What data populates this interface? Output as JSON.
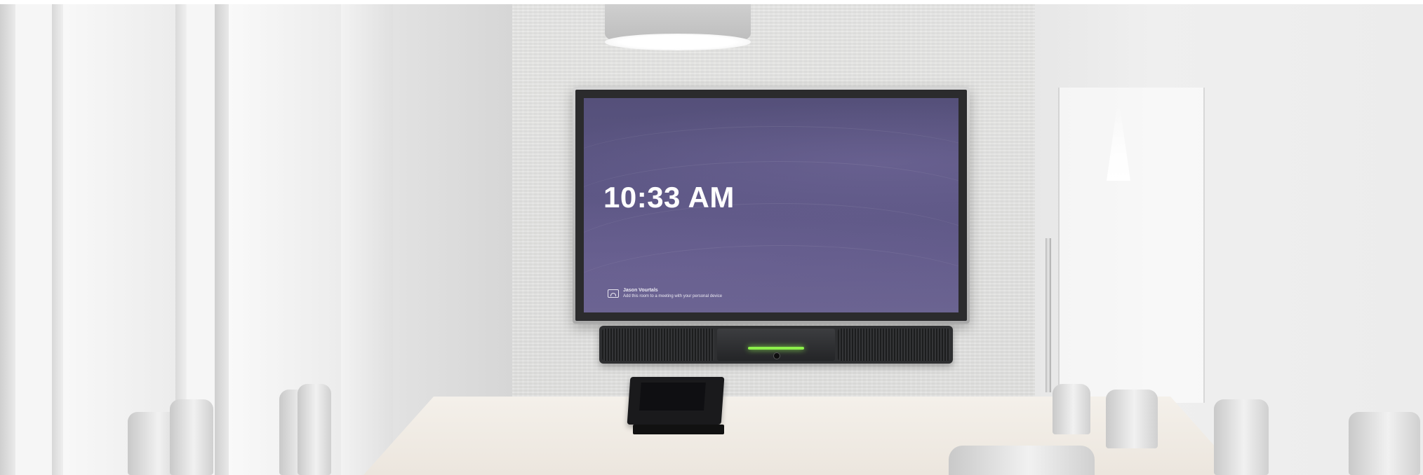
{
  "scene": {
    "subject": "conference room",
    "screen": {
      "clock_text": "10:33 AM",
      "cast_title": "Jason Vourtals",
      "cast_subtitle": "Add this room to a meeting with your personal device",
      "background_color": "#5c5684",
      "text_color": "#ffffff"
    },
    "soundbar": {
      "led_color": "#8cf04a"
    }
  }
}
